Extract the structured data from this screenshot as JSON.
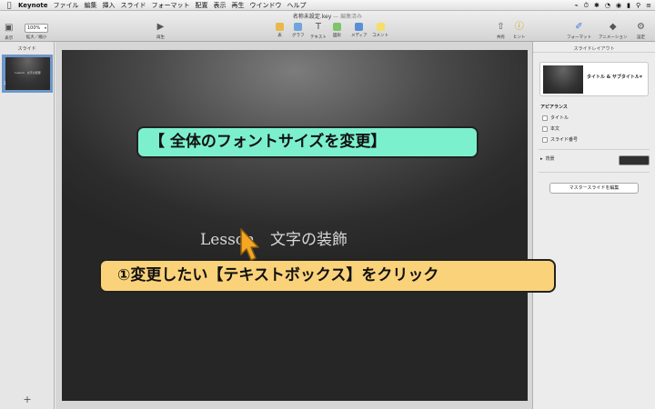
{
  "menubar": {
    "apple_icon": "apple-icon",
    "app_name": "Keynote",
    "items": [
      "ファイル",
      "編集",
      "挿入",
      "スライド",
      "フォーマット",
      "配置",
      "表示",
      "再生",
      "ウインドウ",
      "ヘルプ"
    ],
    "status_icons": [
      "⌁",
      "⏱",
      "✱",
      "◔",
      "◉",
      "▮",
      "⚲",
      "≡"
    ]
  },
  "toolbar": {
    "document_title": "名称未設定.key",
    "document_status": "— 編集済み",
    "view_label": "表示",
    "zoom_value": "100%",
    "zoom_label": "拡大／縮小",
    "play_label": "再生",
    "table_label": "表",
    "chart_label": "グラフ",
    "text_label": "テキスト",
    "shape_label": "図形",
    "media_label": "メディア",
    "comment_label": "コメント",
    "share_label": "共有",
    "tips_label": "ヒント",
    "format_label": "フォーマット",
    "animate_label": "アニメーション",
    "document_label": "設定"
  },
  "slide_panel": {
    "title": "スライド",
    "slide_number": "1",
    "add_label": "+"
  },
  "slide": {
    "text": "Lesson　文字の装飾"
  },
  "inspector": {
    "title": "スライドレイアウト",
    "layout_name": "タイトル & サブタイトル",
    "appearance_heading": "アピアランス",
    "checkbox_title": "タイトル",
    "checkbox_body": "本文",
    "checkbox_slide_number": "スライド番号",
    "background_label": "背景",
    "background_color": "#303030",
    "edit_master_button": "マスタースライドを編集"
  },
  "callouts": {
    "title": "【 全体のフォントサイズを変更】",
    "step": "①変更したい【テキストボックス】をクリック"
  },
  "colors": {
    "callout_title_bg": "#7cf0cd",
    "callout_step_bg": "#fad27a",
    "cursor": "#f5a623",
    "selection": "#6e96c8"
  }
}
